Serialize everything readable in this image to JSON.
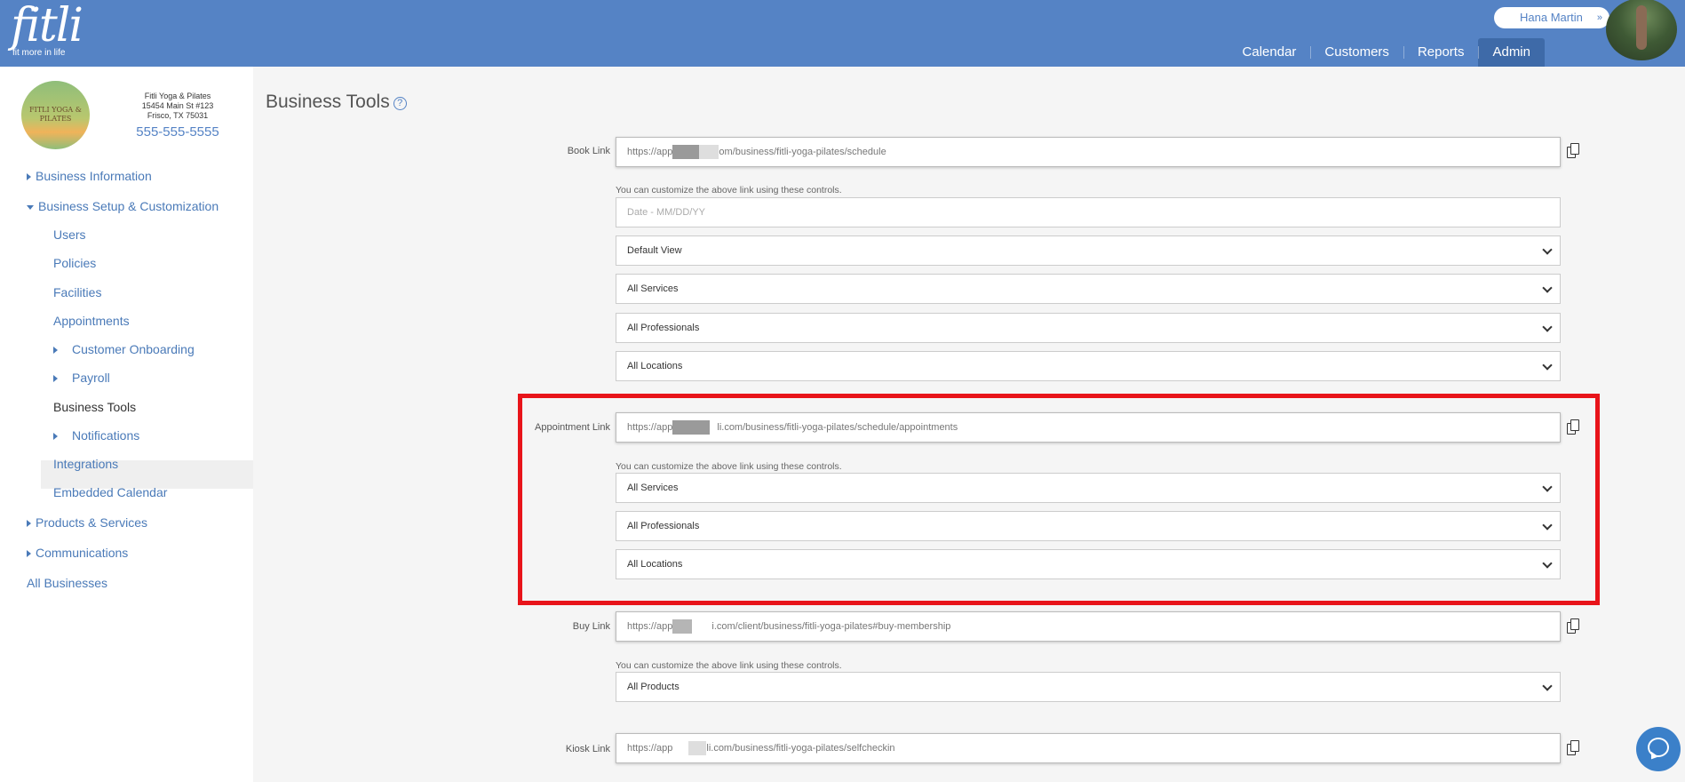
{
  "header": {
    "logo_text": "fitli",
    "logo_tagline": "fit more in life",
    "user_name": "Hana Martin",
    "user_caret": "»",
    "nav": [
      {
        "label": "Calendar"
      },
      {
        "label": "Customers"
      },
      {
        "label": "Reports"
      },
      {
        "label": "Admin",
        "active": true
      }
    ]
  },
  "sidebar": {
    "business_logo_text": "FITLI YOGA & PILATES",
    "business_name": "Fitli Yoga & Pilates",
    "address_line1": "15454 Main St #123",
    "address_line2": "Frisco, TX 75031",
    "phone": "555-555-5555",
    "items": [
      {
        "label": "Business Information"
      },
      {
        "label": "Business Setup & Customization"
      },
      {
        "label": "Users"
      },
      {
        "label": "Policies"
      },
      {
        "label": "Facilities"
      },
      {
        "label": "Appointments"
      },
      {
        "label": "Customer Onboarding"
      },
      {
        "label": "Payroll"
      },
      {
        "label": "Business Tools",
        "active": true
      },
      {
        "label": "Notifications"
      },
      {
        "label": "Integrations"
      },
      {
        "label": "Embedded Calendar"
      },
      {
        "label": "Products & Services"
      },
      {
        "label": "Communications"
      },
      {
        "label": "All Businesses"
      }
    ]
  },
  "main": {
    "title": "Business Tools",
    "help_glyph": "?",
    "customize_hint": "You can customize the above link using these controls.",
    "book": {
      "label": "Book Link",
      "url_prefix": "https://app",
      "url_suffix": "om/business/fitli-yoga-pilates/schedule",
      "date_placeholder": "Date - MM/DD/YY",
      "view": "Default View",
      "services": "All Services",
      "professionals": "All Professionals",
      "locations": "All Locations"
    },
    "appointment": {
      "label": "Appointment Link",
      "url_prefix": "https://app",
      "url_suffix": "li.com/business/fitli-yoga-pilates/schedule/appointments",
      "services": "All Services",
      "professionals": "All Professionals",
      "locations": "All Locations"
    },
    "buy": {
      "label": "Buy Link",
      "url_prefix": "https://app",
      "url_suffix": "i.com/client/business/fitli-yoga-pilates#buy-membership",
      "products": "All Products"
    },
    "kiosk": {
      "label": "Kiosk Link",
      "url_prefix": "https://app",
      "url_suffix": "li.com/business/fitli-yoga-pilates/selfcheckin"
    }
  },
  "colors": {
    "header_bg": "#5583c5",
    "nav_active_bg": "#3e6aa8",
    "link": "#4a7ab8",
    "highlight_border": "#e8141a",
    "chat_button": "#3b80c9"
  }
}
